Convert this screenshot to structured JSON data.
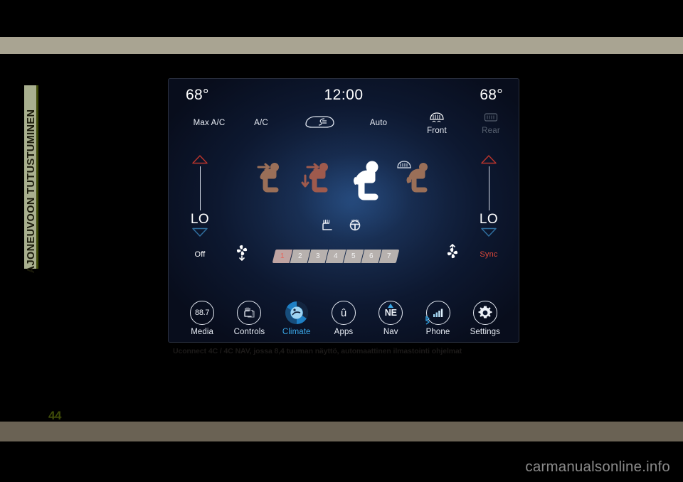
{
  "manual": {
    "side_tab_label": "AJONEUVOON TUTUSTUMINEN",
    "page_number": "44",
    "figure_caption": "Uconnect 4C / 4C NAV, jossa 8,4 tuuman näyttö, automaattinen ilmastointi ohjelmat",
    "site_footer": "carmanualsonline.info"
  },
  "screen": {
    "status": {
      "temp_left": "68°",
      "clock": "12:00",
      "temp_right": "68°"
    },
    "top_controls": [
      {
        "label": "Max A/C",
        "icon": "max-ac-text",
        "state": "on"
      },
      {
        "label": "A/C",
        "icon": "ac-text",
        "state": "on"
      },
      {
        "label": "",
        "icon": "recirculate-icon",
        "state": "on"
      },
      {
        "label": "Auto",
        "icon": "auto-text",
        "state": "on"
      },
      {
        "label": "Front",
        "icon": "front-defrost-icon",
        "state": "on"
      },
      {
        "label": "Rear",
        "icon": "rear-defrost-icon",
        "state": "off"
      }
    ],
    "temp_left_control": {
      "up_icon": "triangle-up-icon",
      "value": "LO",
      "down_icon": "triangle-down-icon",
      "sub_label": "Off",
      "sub_color": "#ffffff"
    },
    "temp_right_control": {
      "up_icon": "triangle-up-icon",
      "value": "LO",
      "down_icon": "triangle-down-icon",
      "sub_label": "Sync",
      "sub_color": "#e0493a"
    },
    "airflow_modes": [
      {
        "name": "airflow-face-icon",
        "state": "off"
      },
      {
        "name": "airflow-face-feet-icon",
        "state": "off"
      },
      {
        "name": "airflow-feet-icon",
        "state": "on"
      },
      {
        "name": "airflow-defrost-feet-icon",
        "state": "off"
      }
    ],
    "heat_controls": [
      {
        "name": "heated-seat-icon",
        "state": "off"
      },
      {
        "name": "heated-steering-wheel-icon",
        "state": "off"
      }
    ],
    "fan": {
      "left_icon": "fan-decrease-icon",
      "right_icon": "fan-increase-icon",
      "segments": [
        "1",
        "2",
        "3",
        "4",
        "5",
        "6",
        "7"
      ],
      "active_index": 0,
      "active_color": "#e8635a"
    },
    "nav_items": [
      {
        "label": "Media",
        "icon": "radio-frequency-icon",
        "badge": "88.7",
        "active": false
      },
      {
        "label": "Controls",
        "icon": "controls-icon",
        "badge": "",
        "active": false
      },
      {
        "label": "Climate",
        "icon": "climate-icon",
        "badge": "",
        "active": true
      },
      {
        "label": "Apps",
        "icon": "uconnect-apps-icon",
        "badge": "û",
        "active": false
      },
      {
        "label": "Nav",
        "icon": "compass-nav-icon",
        "badge": "NE",
        "active": false
      },
      {
        "label": "Phone",
        "icon": "phone-signal-icon",
        "badge": "",
        "active": false
      },
      {
        "label": "Settings",
        "icon": "gear-icon",
        "badge": "",
        "active": false
      }
    ],
    "colors": {
      "accent_blue": "#3aa8e8",
      "warm_red": "#e0493a",
      "cool_blue": "#2f6e9e",
      "text_primary": "#ffffff",
      "text_dim": "#56606f"
    }
  }
}
